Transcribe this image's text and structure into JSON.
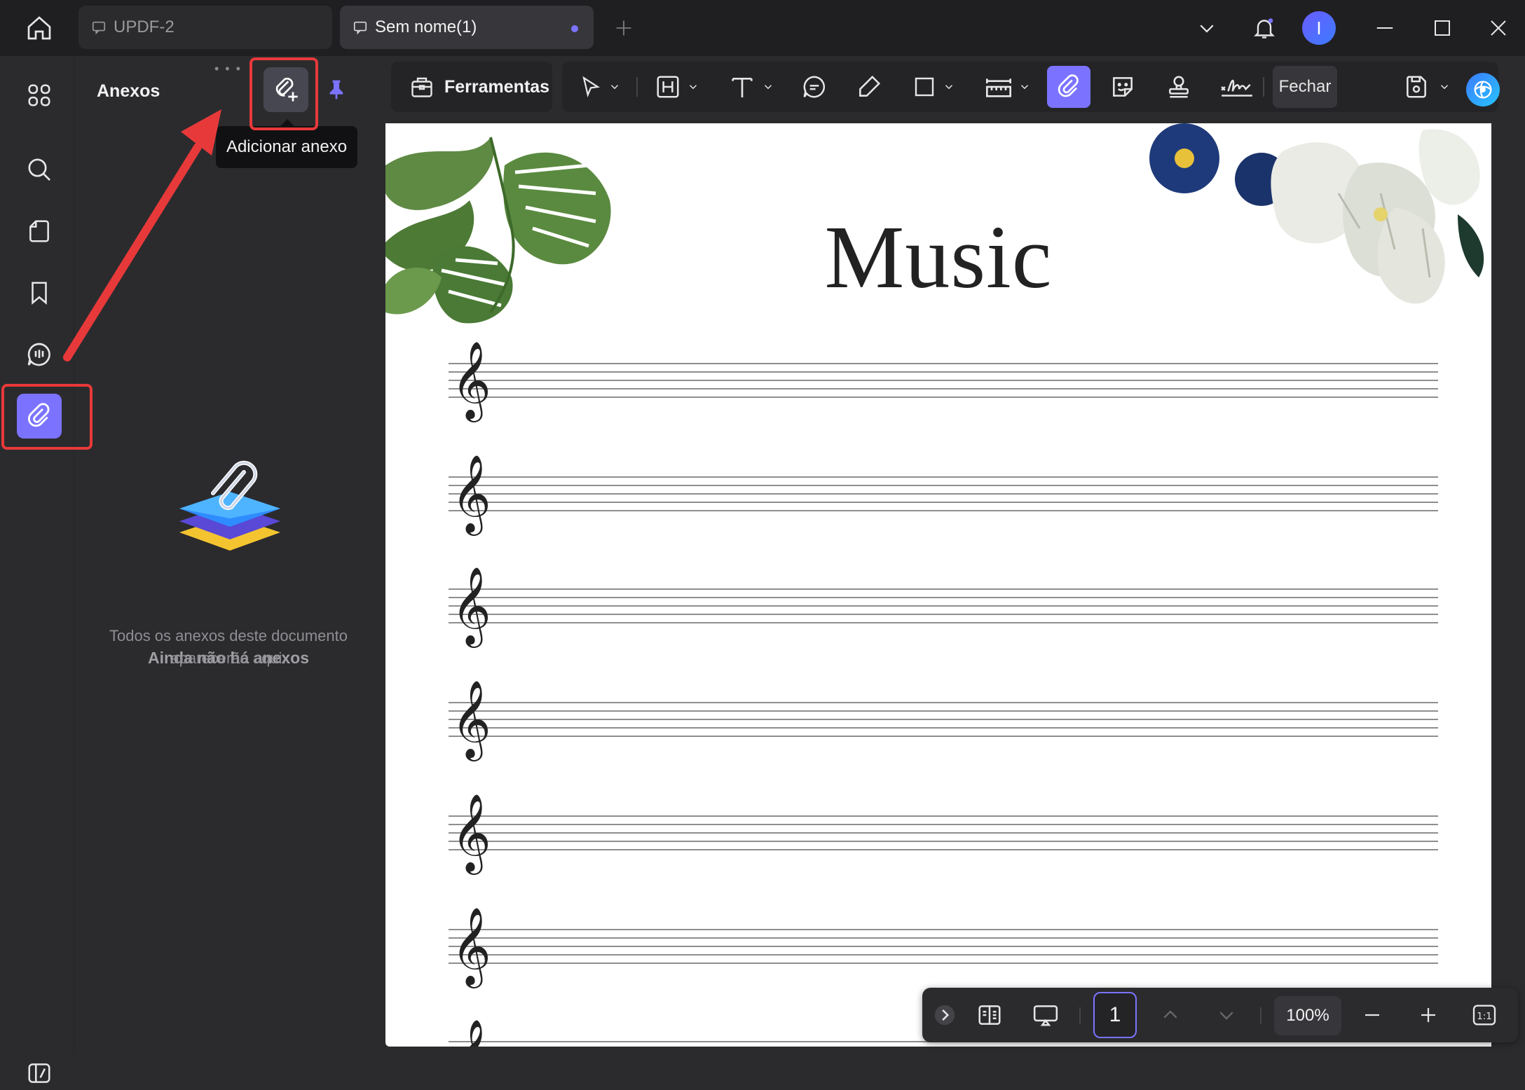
{
  "titlebar": {
    "tabs": [
      {
        "label": "UPDF-2"
      },
      {
        "label": "Sem nome(1)"
      }
    ],
    "avatar_initial": "I"
  },
  "panel": {
    "title": "Anexos",
    "tooltip": "Adicionar anexo",
    "empty_title": "Ainda não há anexos",
    "empty_description": "Todos os anexos deste documento aparecerão aqui."
  },
  "toolbar": {
    "tools_label": "Ferramentas",
    "close_label": "Fechar"
  },
  "document": {
    "title": "Music",
    "staff_count": 7
  },
  "navbar": {
    "page_number": "1",
    "zoom": "100%",
    "fit_label": "1:1"
  },
  "colors": {
    "accent": "#7b73ff",
    "highlight": "#e8393a"
  }
}
